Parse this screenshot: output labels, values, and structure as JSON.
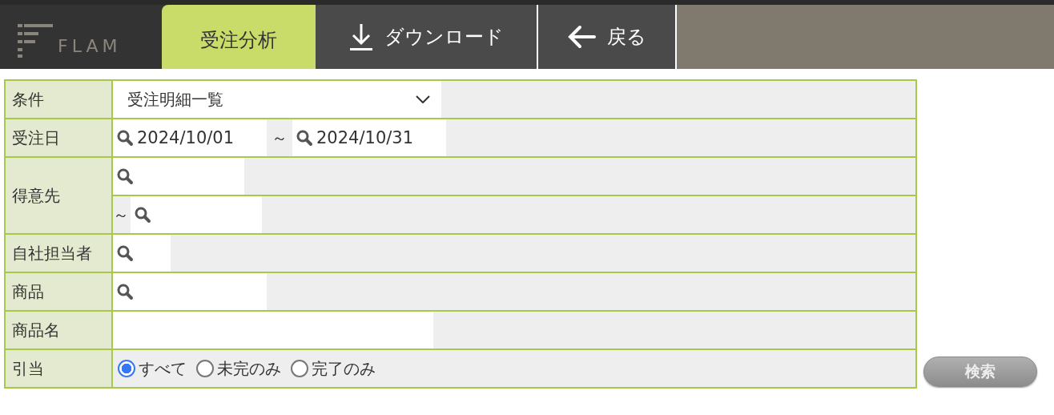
{
  "header": {
    "logo": "FLAM",
    "tabs": [
      {
        "label": "受注分析",
        "kind": "plain",
        "selected": true
      },
      {
        "label": "ダウンロード",
        "kind": "download",
        "selected": false
      },
      {
        "label": "戻る",
        "kind": "back",
        "selected": false
      }
    ]
  },
  "form": {
    "rows": [
      {
        "label": "条件",
        "kind": "select",
        "value": "受注明細一覧"
      },
      {
        "label": "受注日",
        "kind": "date_range",
        "from": "2024/10/01",
        "separator": "～",
        "to": "2024/10/31"
      },
      {
        "label": "得意先",
        "kind": "search_range",
        "separator": "～"
      },
      {
        "label": "自社担当者",
        "kind": "search"
      },
      {
        "label": "商品",
        "kind": "search"
      },
      {
        "label": "商品名",
        "kind": "text"
      },
      {
        "label": "引当",
        "kind": "radio",
        "options": [
          {
            "label": "すべて",
            "selected": true
          },
          {
            "label": "未完のみ",
            "selected": false
          },
          {
            "label": "完了のみ",
            "selected": false
          }
        ]
      }
    ]
  },
  "search_button": "検索"
}
